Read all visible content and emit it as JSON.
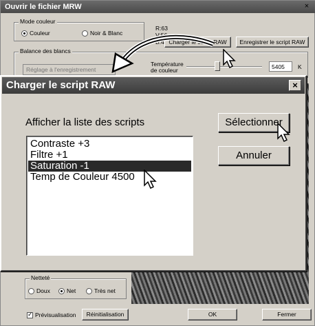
{
  "background_window": {
    "title": "Ouvrir le fichier MRW",
    "close": "×",
    "color_mode": {
      "legend": "Mode couleur",
      "options": [
        "Couleur",
        "Noir & Blanc"
      ],
      "selected": "Couleur"
    },
    "rgb": {
      "r": "R:63",
      "v": "V:56",
      "b": "B:45"
    },
    "load_script_button": "Charger le script RAW",
    "save_script_button": "Enregistrer le script RAW",
    "white_balance": {
      "legend": "Balance des blancs",
      "preset": "Réglage à l'enregistrement",
      "temp_label_line1": "Température",
      "temp_label_line2": "de couleur",
      "temp_value": "5405",
      "temp_unit": "K"
    },
    "sharpness": {
      "legend": "Netteté",
      "options": [
        "Doux",
        "Net",
        "Très net"
      ],
      "selected": "Net"
    },
    "preview_checkbox": "Prévisualisation",
    "preview_checked": true,
    "reset_button": "Réinitialisation",
    "ok_button": "OK",
    "close_button": "Fermer"
  },
  "dialog": {
    "title": "Charger le script RAW",
    "close": "×",
    "list_label": "Afficher la liste des scripts",
    "scripts": [
      {
        "label": "Contraste +3",
        "selected": false
      },
      {
        "label": "Filtre +1",
        "selected": false
      },
      {
        "label": "Saturation -1",
        "selected": true
      },
      {
        "label": "Temp de Couleur 4500",
        "selected": false
      }
    ],
    "select_button": "Sélectionner",
    "cancel_button": "Annuler"
  }
}
